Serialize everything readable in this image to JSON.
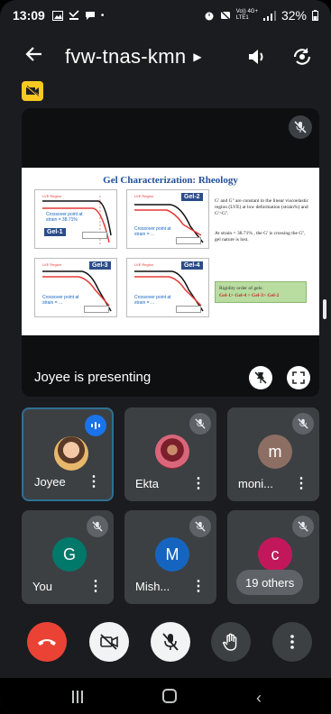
{
  "status_bar": {
    "time": "13:09",
    "left_icons": [
      "gallery-icon",
      "missed-call-icon",
      "chat-bubble-icon",
      "dot-icon"
    ],
    "right_icons": [
      "alarm-icon",
      "mute-icon",
      "volte-icon",
      "4g-signal-icon"
    ],
    "network_top": "Vo)) 4G+",
    "network_bottom": "LTE1",
    "battery": "32%"
  },
  "header": {
    "meeting_code": "fvw-tnas-kmn",
    "icons": [
      "back-arrow-icon",
      "dropdown-caret-icon",
      "speaker-icon",
      "flip-camera-icon"
    ]
  },
  "recording_badge": {
    "icon": "no-recording-icon",
    "color": "#f9c921"
  },
  "presentation": {
    "presenter_label": "Joyee is presenting",
    "slide": {
      "title": "Gel Characterization: Rheology",
      "graphs": [
        {
          "label": "Gel-1",
          "red_note": "LVE Region",
          "crossover": "Crossover point at strain = 38.71%",
          "legend": "Storage Modulus G' / Loss Modulus G''"
        },
        {
          "label": "Gel-2",
          "red_note": "LVE Region",
          "crossover": "Crossover point at strain = ...",
          "legend": "Storage Modulus G' / Loss Modulus G''"
        },
        {
          "label": "Gel-3",
          "red_note": "LVE Region",
          "crossover": "Crossover point at strain = ...",
          "legend": "Storage Modulus G' / Loss Modulus G''"
        },
        {
          "label": "Gel-4",
          "red_note": "LVE Region",
          "crossover": "Crossover point at strain = ...",
          "legend": "Storage Modulus G' / Loss Modulus G''"
        }
      ],
      "text1": "G' and G'' are constant in the linear viscoelastic region (LVE) at low deformation (strain%) and G'>G''.",
      "text2": "At strain = 38.71% , the G' is crossing the G'', gel nature is lost.",
      "rigidity_title": "Rigidity order of gels:",
      "rigidity_order": "Gel-1> Gel-4 > Gel-3> Gel-2"
    }
  },
  "participants": [
    {
      "name": "Joyee",
      "avatar_type": "photo",
      "status": "speaking",
      "avatar_letter": "",
      "avatar_color": ""
    },
    {
      "name": "Ekta",
      "avatar_type": "photo",
      "status": "muted",
      "avatar_letter": "",
      "avatar_color": ""
    },
    {
      "name": "moni...",
      "avatar_type": "letter",
      "status": "muted",
      "avatar_letter": "m",
      "avatar_color": "#8d6e63"
    },
    {
      "name": "You",
      "avatar_type": "letter",
      "status": "muted",
      "avatar_letter": "G",
      "avatar_color": "#00796b"
    },
    {
      "name": "Mish...",
      "avatar_type": "letter",
      "status": "muted",
      "avatar_letter": "M",
      "avatar_color": "#1565c0"
    },
    {
      "name": "c",
      "avatar_type": "letter",
      "status": "muted",
      "avatar_letter": "c",
      "avatar_color": "#c2185b"
    }
  ],
  "others_count": "19 others",
  "controls": [
    "hang-up-icon",
    "camera-off-icon",
    "mic-off-icon",
    "raise-hand-icon",
    "more-options-icon"
  ],
  "colors": {
    "background": "#1a1c20",
    "tile": "#3c4043",
    "hangup": "#ea4335",
    "accent": "#1a73e8"
  }
}
